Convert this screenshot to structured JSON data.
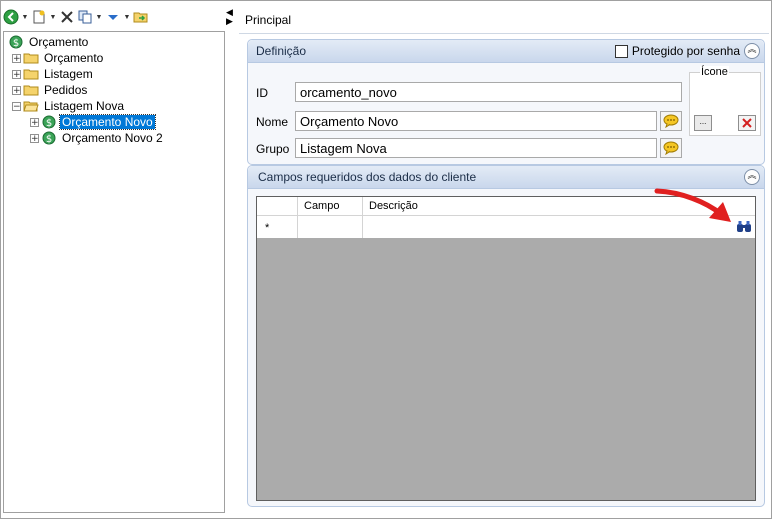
{
  "toolbar": {
    "buttons": [
      {
        "name": "back-icon"
      },
      {
        "name": "new-document-icon"
      },
      {
        "name": "delete-icon"
      },
      {
        "name": "copy-icon"
      },
      {
        "name": "move-down-icon"
      },
      {
        "name": "import-folder-icon"
      }
    ]
  },
  "tree": {
    "root": "Orçamento",
    "items": [
      {
        "label": "Orçamento",
        "level": 1,
        "expander": "+",
        "icon": "folder-icon"
      },
      {
        "label": "Listagem",
        "level": 1,
        "expander": "+",
        "icon": "folder-icon"
      },
      {
        "label": "Pedidos",
        "level": 1,
        "expander": "+",
        "icon": "folder-icon"
      },
      {
        "label": "Listagem Nova",
        "level": 1,
        "expander": "−",
        "icon": "folder-open-icon"
      },
      {
        "label": "Orçamento Novo",
        "level": 2,
        "expander": "+",
        "icon": "money-icon",
        "selected": true
      },
      {
        "label": "Orçamento Novo 2",
        "level": 2,
        "expander": "+",
        "icon": "money-icon"
      }
    ]
  },
  "tab": {
    "title": "Principal"
  },
  "definicao": {
    "title": "Definição",
    "protected_label": "Protegido por senha",
    "id_label": "ID",
    "id_value": "orcamento_novo",
    "nome_label": "Nome",
    "nome_value": "Orçamento Novo",
    "grupo_label": "Grupo",
    "grupo_value": "Listagem Nova",
    "icone_label": "Ícone",
    "dots_label": "..."
  },
  "campos": {
    "title": "Campos requeridos dos dados do cliente",
    "columns": [
      "Campo",
      "Descrição"
    ],
    "new_row_marker": "*"
  },
  "colors": {
    "accent": "#0078d7",
    "group_header": "#c9d7ec",
    "grid_empty": "#ababab",
    "arrow": "#e02020"
  }
}
